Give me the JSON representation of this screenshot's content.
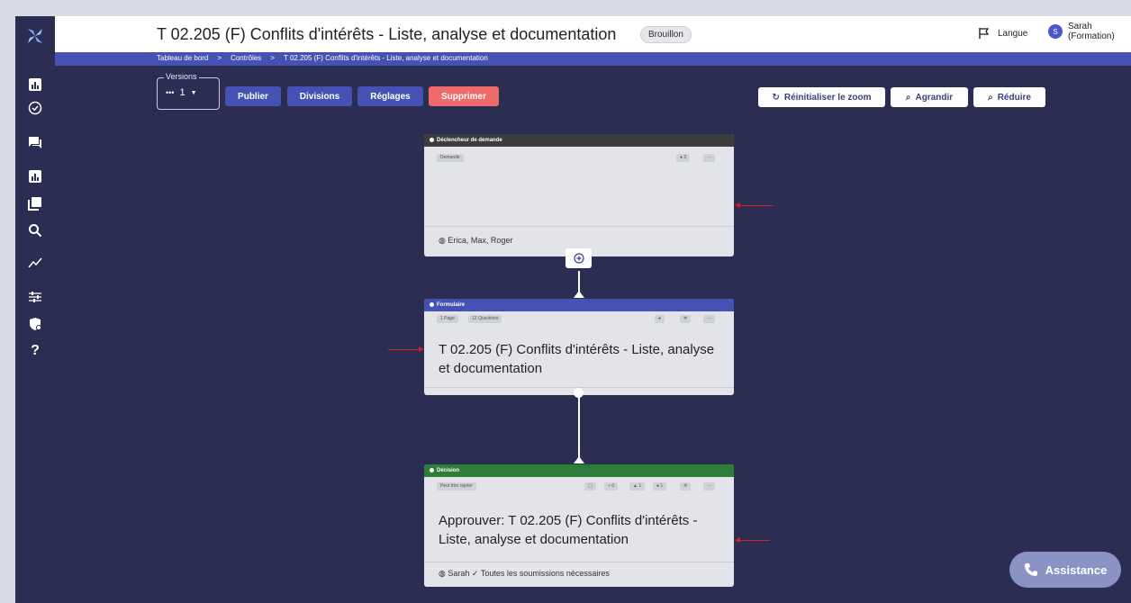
{
  "header": {
    "title": "T 02.205 (F) Conflits d'intérêts - Liste, analyse et documentation",
    "status": "Brouillon",
    "language_label": "Langue",
    "user_initial": "S",
    "user_name": "Sarah",
    "user_role": "(Formation)"
  },
  "breadcrumb": {
    "items": [
      "Tableau de bord",
      ">",
      "Contrôles",
      ">",
      "T 02.205 (F) Conflits d'intérêts - Liste, analyse et documentation"
    ]
  },
  "toolbar": {
    "versions_label": "Versions",
    "version_value": "1",
    "publish_label": "Publier",
    "divisions_label": "Divisions",
    "settings_label": "Réglages",
    "delete_label": "Supprimer",
    "reset_zoom_label": "Réinitialiser le zoom",
    "zoom_in_label": "Agrandir",
    "zoom_out_label": "Réduire"
  },
  "nodes": {
    "trigger": {
      "type_label": "Déclencheur de demande",
      "chip": "Demande",
      "count": "3",
      "more": "···",
      "assignees": "Erica, Max, Roger"
    },
    "form": {
      "type_label": "Formulaire",
      "chip_pages": "1 Page",
      "chip_questions": "12 Questions",
      "more": "···",
      "title": "T 02.205 (F) Conflits d'intérêts - Liste, analyse et documentation"
    },
    "decision": {
      "type_label": "Décision",
      "chip": "Peut être rejeter",
      "count_a": "0",
      "count_b": "1",
      "count_c": "1",
      "more": "···",
      "title": "Approuver: T 02.205 (F) Conflits d'intérêts - Liste, analyse et documentation",
      "assignee": "Sarah",
      "requirement": "Toutes les soumissions nécessaires"
    }
  },
  "assistance_label": "Assistance",
  "colors": {
    "sidebar": "#2b2d52",
    "canvas": "#2b2d52",
    "breadcrumb_bar": "#4552b4",
    "primary_button": "#4552b4",
    "delete_button": "#ef6b6b",
    "trigger_header": "#3d3d3d",
    "form_header": "#4552b4",
    "decision_header": "#2f7d3a",
    "arrow": "#d0202a"
  },
  "icons": [
    "logo-icon",
    "dashboard-icon",
    "check-circle-icon",
    "chat-icon",
    "bar-chart-icon",
    "library-icon",
    "search-icon",
    "trend-icon",
    "sliders-icon",
    "shield-icon",
    "help-icon",
    "flag-icon",
    "reset-icon",
    "zoom-in-icon",
    "zoom-out-icon",
    "add-icon",
    "phone-icon"
  ]
}
